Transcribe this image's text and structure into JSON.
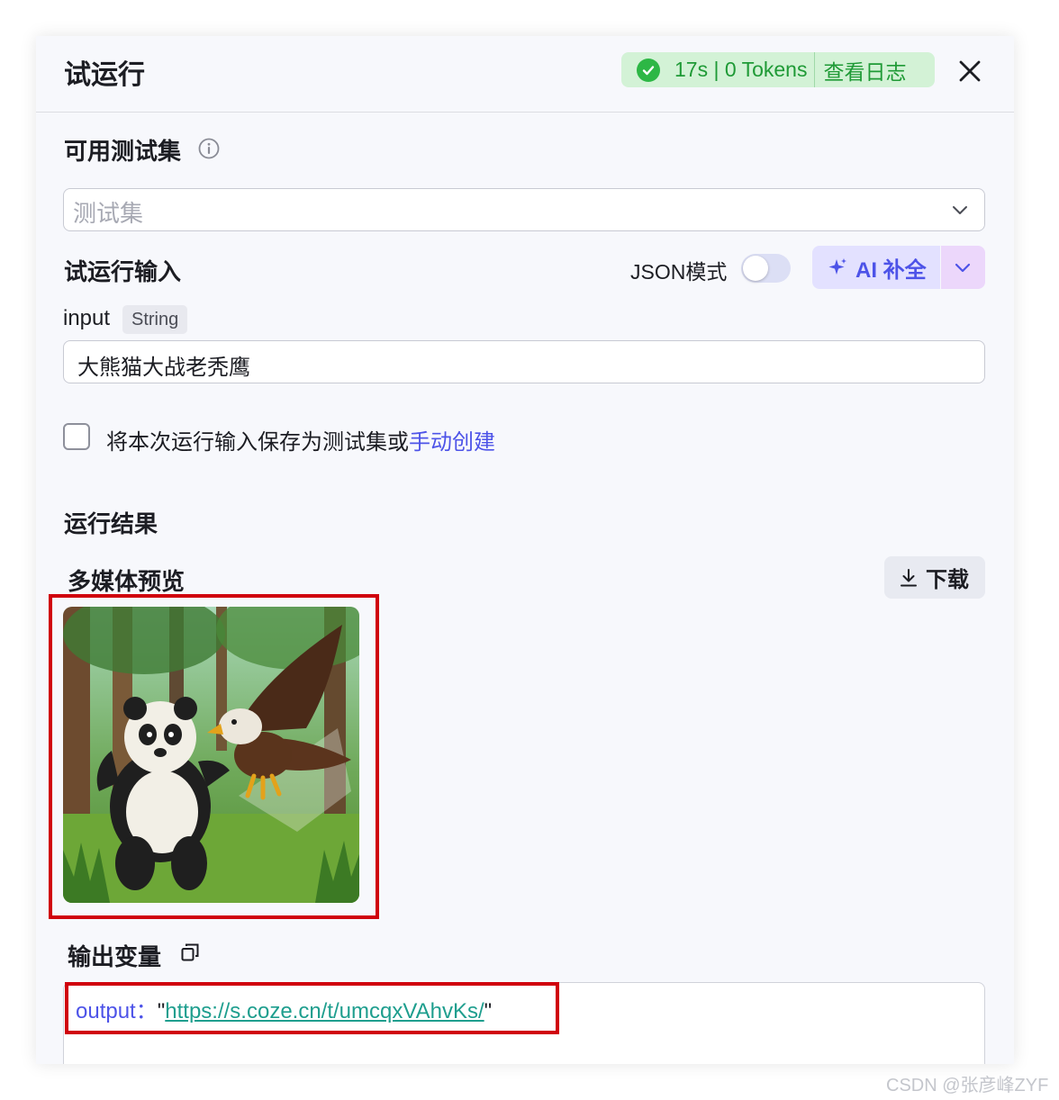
{
  "header": {
    "title": "试运行",
    "status_stats": "17s | 0 Tokens",
    "view_log_label": "查看日志",
    "status_color": "#2db745"
  },
  "testset": {
    "label": "可用测试集",
    "placeholder": "测试集"
  },
  "run_input": {
    "label": "试运行输入",
    "json_mode_label": "JSON模式",
    "json_mode_on": false,
    "ai_button_label": "AI 补全",
    "field_name": "input",
    "field_type": "String",
    "field_value": "大熊猫大战老秃鹰"
  },
  "save_option": {
    "text": "将本次运行输入保存为测试集或",
    "link": "手动创建",
    "checked": false
  },
  "result": {
    "label": "运行结果",
    "media_label": "多媒体预览",
    "download_label": "下载",
    "output_label": "输出变量",
    "output_key": "output：",
    "output_url": "https://s.coze.cn/t/umcqxVAhvKs/"
  },
  "watermark": "CSDN @张彦峰ZYF",
  "colors": {
    "accent": "#4d53e8",
    "success_bg": "#d3f2d6",
    "highlight_border": "#d0000c",
    "link_green": "#1e9e8e"
  }
}
